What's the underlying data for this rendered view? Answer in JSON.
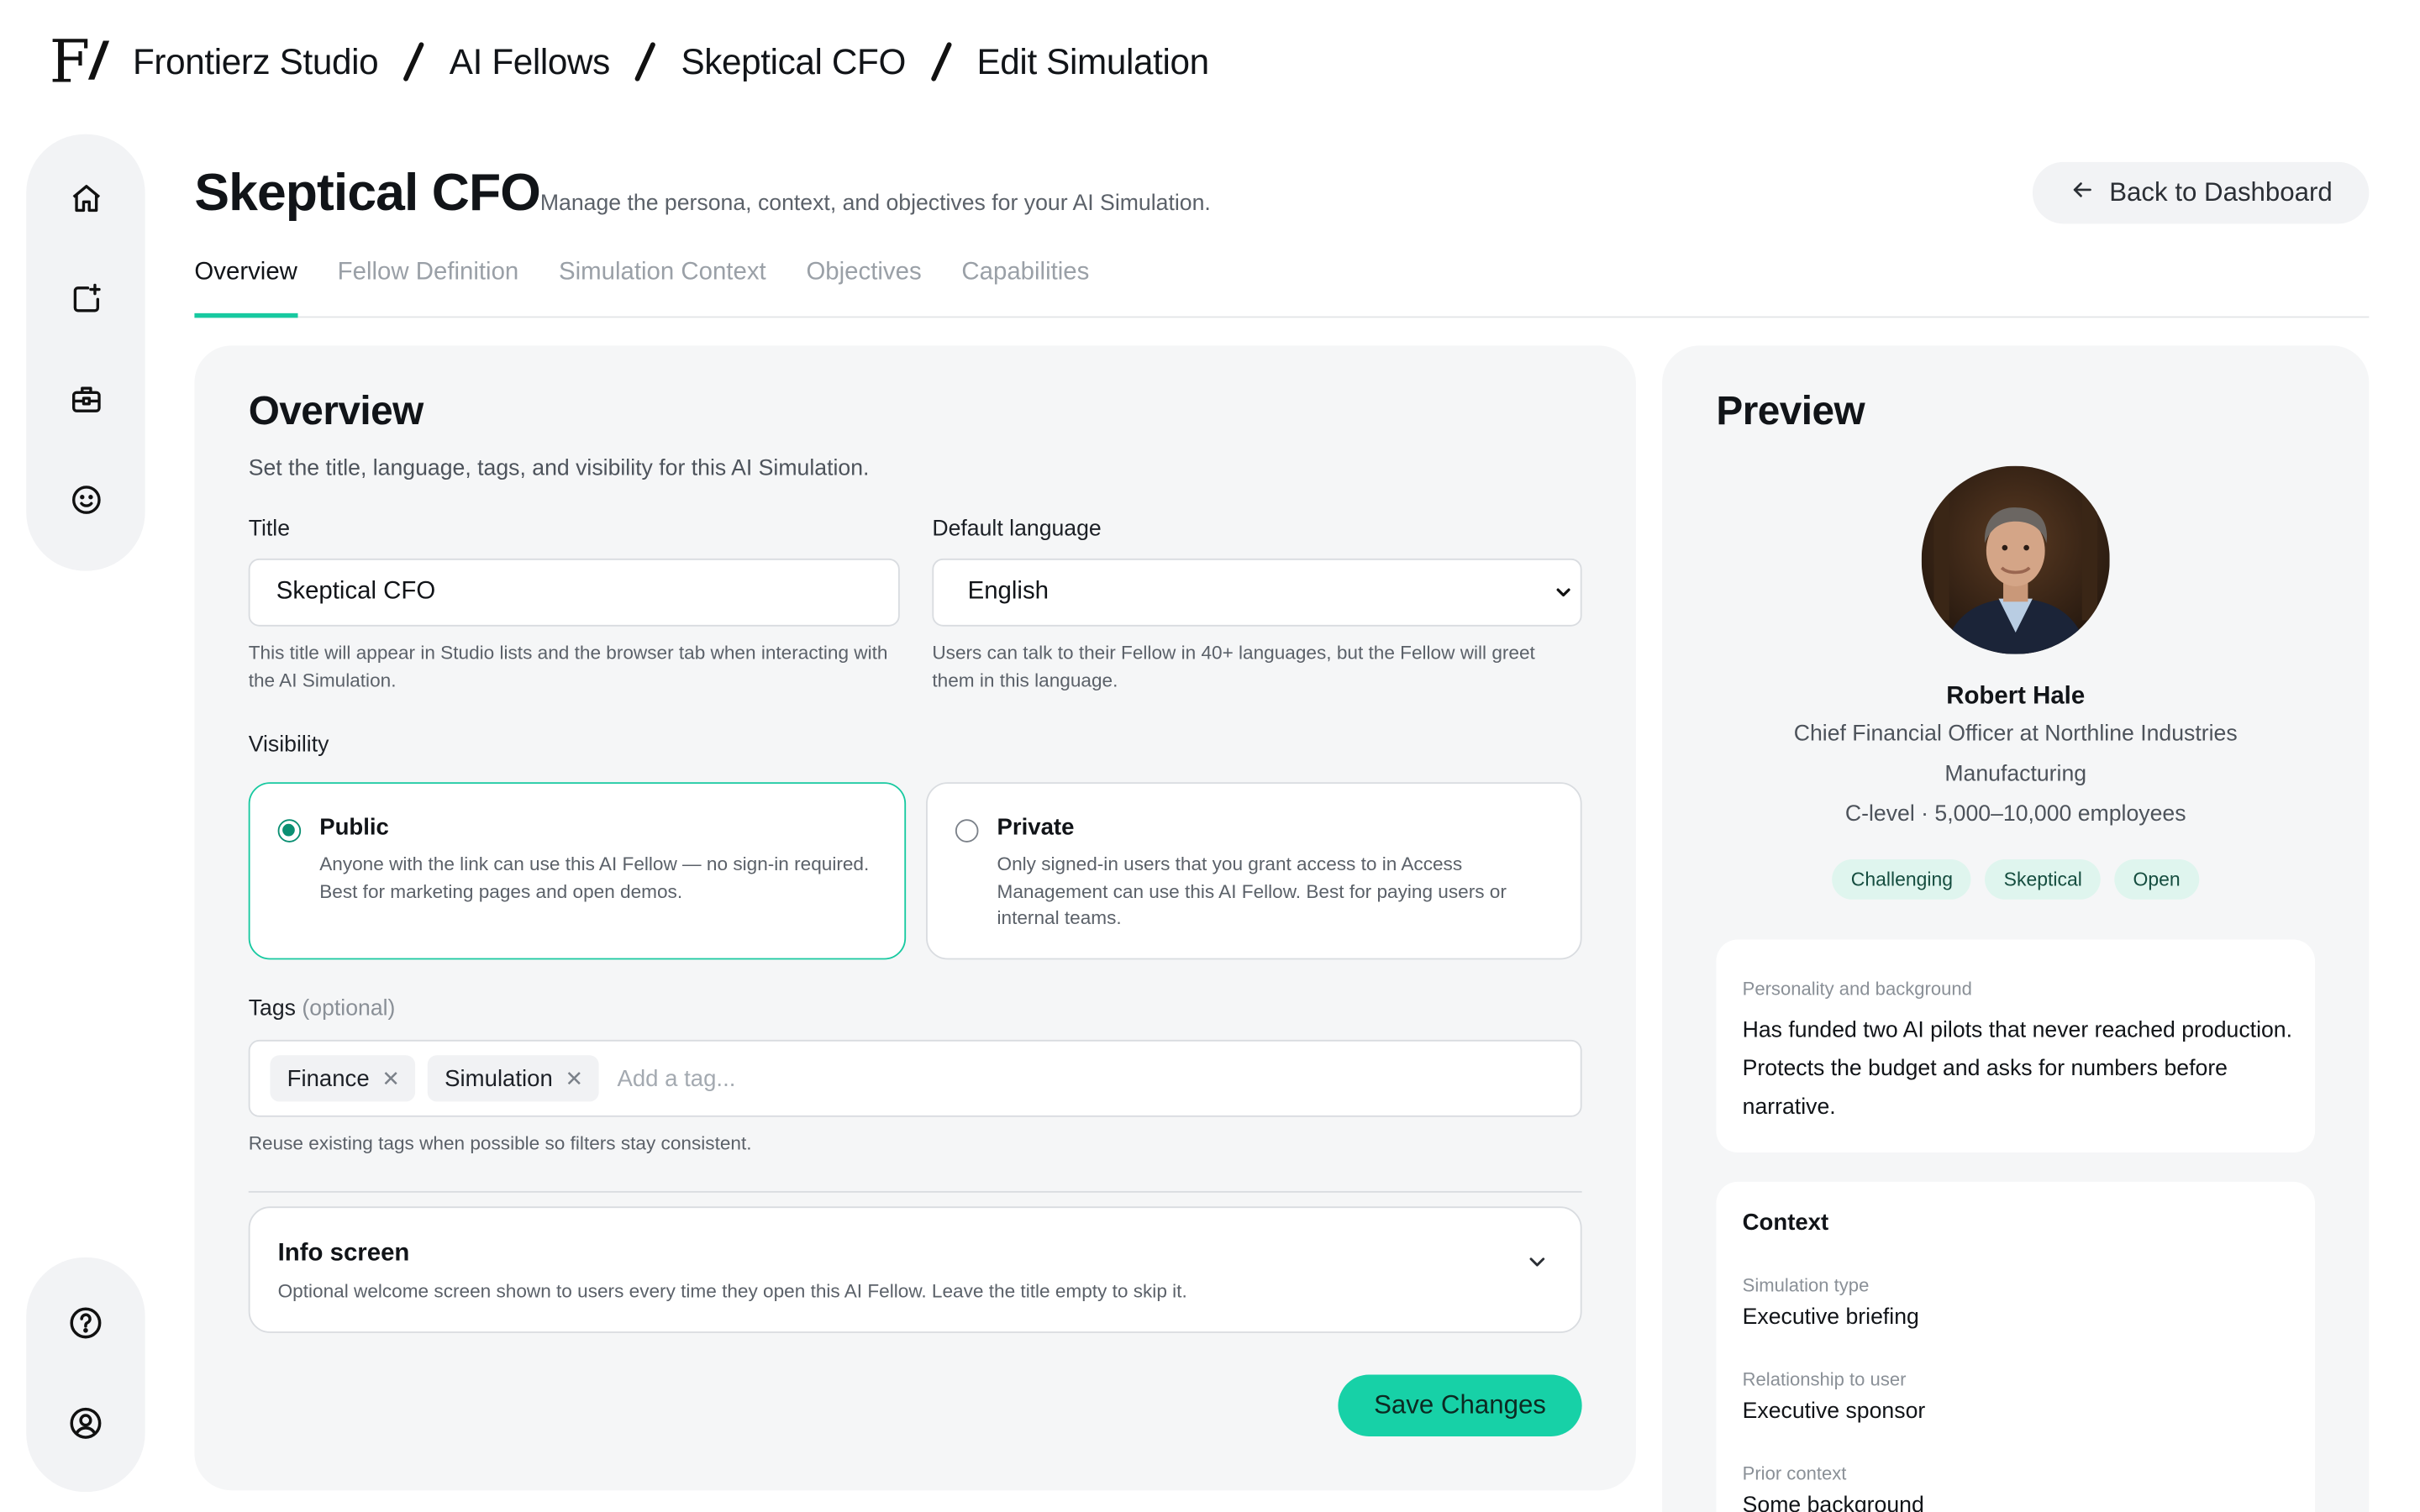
{
  "breadcrumb": {
    "items": [
      "Frontierz Studio",
      "AI Fellows",
      "Skeptical CFO",
      "Edit Simulation"
    ],
    "logo_text": "F",
    "logo_slash": "/"
  },
  "header": {
    "title": "Skeptical CFO",
    "subtitle": "Manage the persona, context, and objectives for your AI Simulation.",
    "back_label": "Back to Dashboard"
  },
  "tabs": [
    {
      "label": "Overview",
      "active": true
    },
    {
      "label": "Fellow Definition",
      "active": false
    },
    {
      "label": "Simulation Context",
      "active": false
    },
    {
      "label": "Objectives",
      "active": false
    },
    {
      "label": "Capabilities",
      "active": false
    }
  ],
  "sidebar": {
    "top_icons": [
      "home-icon",
      "new-document-sparkle-icon",
      "briefcase-icon",
      "smiley-icon"
    ],
    "bottom_icons": [
      "help-icon",
      "user-account-icon"
    ]
  },
  "overview": {
    "heading": "Overview",
    "description": "Set the title, language, tags, and visibility for this AI Simulation.",
    "title_label": "Title",
    "title_value": "Skeptical CFO",
    "title_hint": "This title will appear in Studio lists and the browser tab when interacting with the AI Simulation.",
    "language_label": "Default language",
    "language_value": "English",
    "language_hint": "Users can talk to their Fellow in 40+ languages, but the Fellow will greet them in this language.",
    "visibility_label": "Visibility",
    "visibility_options": [
      {
        "title": "Public",
        "desc": "Anyone with the link can use this AI Fellow — no sign-in required. Best for marketing pages and open demos.",
        "selected": true
      },
      {
        "title": "Private",
        "desc": "Only signed-in users that you grant access to in Access Management can use this AI Fellow. Best for paying users or internal teams.",
        "selected": false
      }
    ],
    "tags_label": "Tags",
    "tags_optional": "(optional)",
    "tags": [
      "Finance",
      "Simulation"
    ],
    "tag_remove_glyph": "✕",
    "tags_placeholder": "Add a tag...",
    "tags_hint": "Reuse existing tags when possible so filters stay consistent.",
    "info_title": "Info screen",
    "info_desc": "Optional welcome screen shown to users every time they open this AI Fellow. Leave the title empty to skip it.",
    "save_label": "Save Changes"
  },
  "preview": {
    "heading": "Preview",
    "name": "Robert Hale",
    "role": "Chief Financial Officer at Northline Industries",
    "industry": "Manufacturing",
    "level": "C-level · 5,000–10,000 employees",
    "traits": [
      "Challenging",
      "Skeptical",
      "Open"
    ],
    "personality_label": "Personality and background",
    "personality_text": "Has funded two AI pilots that never reached production. Protects the budget and asks for numbers before narrative.",
    "context_heading": "Context",
    "context_items": [
      {
        "label": "Simulation type",
        "value": "Executive briefing"
      },
      {
        "label": "Relationship to user",
        "value": "Executive sponsor"
      },
      {
        "label": "Prior context",
        "value": "Some background"
      }
    ]
  },
  "colors": {
    "accent": "#17d1a7",
    "accent_dark": "#0a8f72",
    "chip_bg": "#dff5ee",
    "card_bg": "#f5f6f7"
  }
}
